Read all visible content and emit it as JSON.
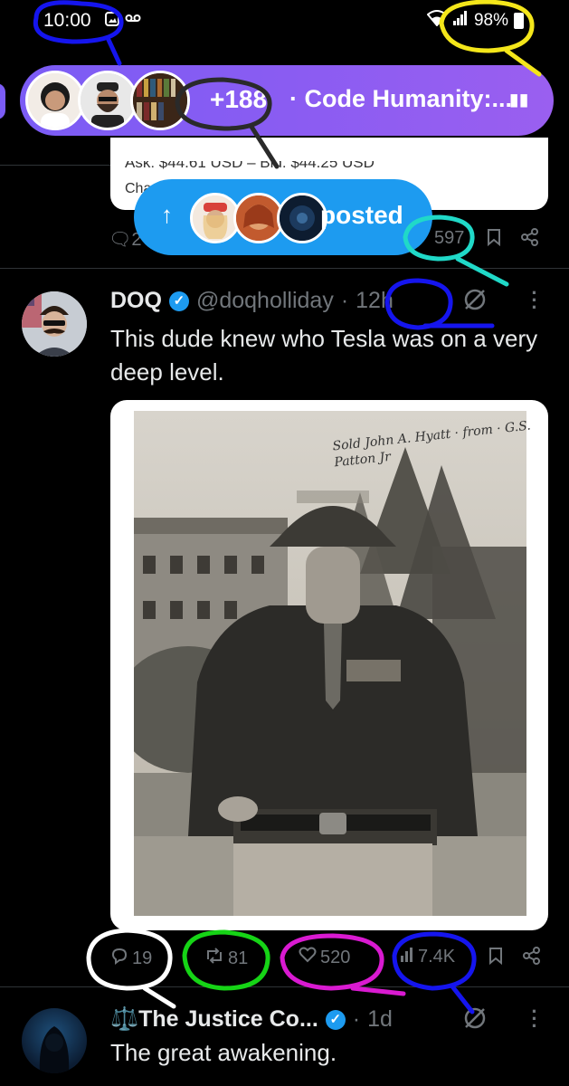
{
  "status_bar": {
    "time": "10:00",
    "battery": "98%",
    "left_icons": [
      "image-icon",
      "voicemail-icon"
    ],
    "right_icons": [
      "wifi-icon",
      "signal-icon",
      "battery-icon"
    ]
  },
  "space": {
    "count": "+188",
    "separator": "·",
    "title": "Code Humanity:...",
    "color": "#7b5cf5"
  },
  "previous_tweet": {
    "card_line": "Ask: $44.61 USD – Bid: $44.25 USD",
    "card_line2": "Cha",
    "reply_count": "2",
    "views": "597"
  },
  "posted_pill": {
    "arrow": "↑",
    "label": "posted",
    "color": "#1d9bf0"
  },
  "tweet": {
    "name": "DOQ",
    "handle": "@doqholliday",
    "dot": "·",
    "time": "12h",
    "text": "This dude knew who Tesla was on a very deep level.",
    "photo_signature": "Sold John A. Hyatt · from · G.S. Patton Jr",
    "actions": {
      "replies": "19",
      "reposts": "81",
      "likes": "520",
      "views": "7.4K"
    }
  },
  "next_tweet": {
    "name": "⚖️The Justice Co...",
    "dot": "·",
    "time": "1d",
    "text": "The great awakening."
  },
  "colors": {
    "background": "#000000",
    "text": "#e7e9ea",
    "muted": "#71767b",
    "accent": "#1d9bf0"
  }
}
